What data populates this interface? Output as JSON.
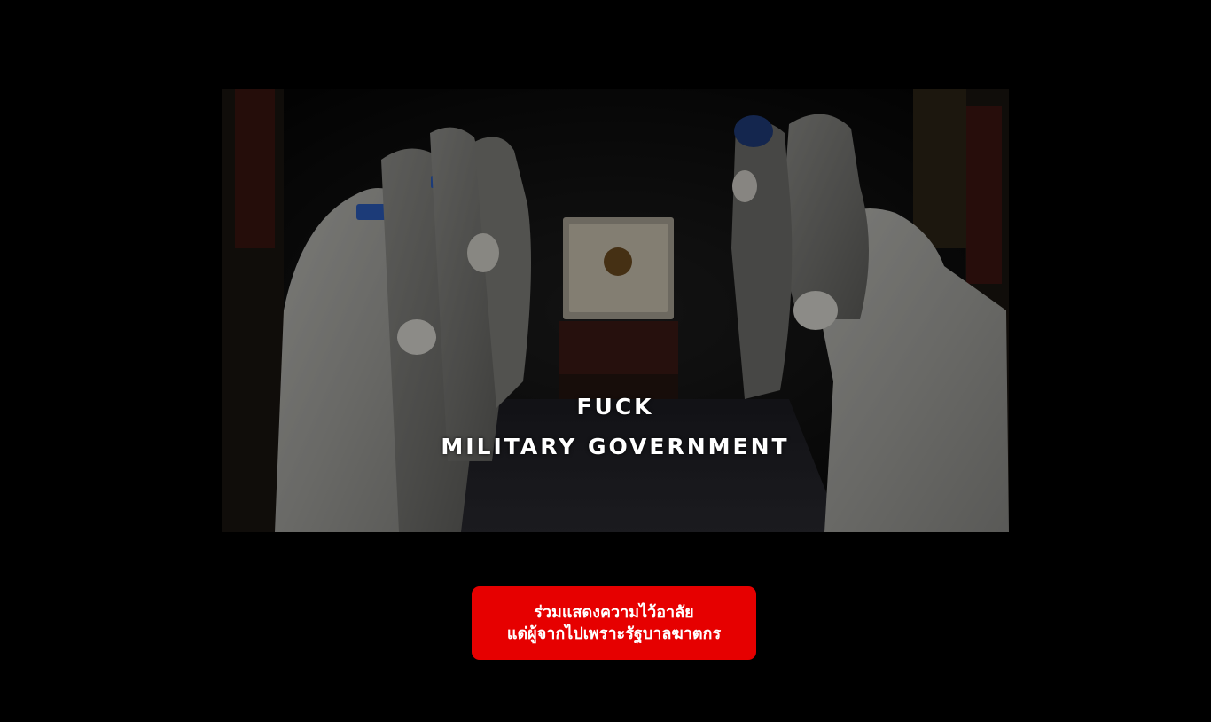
{
  "hero": {
    "caption_line1": "FUCK",
    "caption_line2": "MILITARY GOVERNMENT"
  },
  "cta": {
    "line1": "ร่วมแสดงความไว้อาลัย",
    "line2": "แด่ผู้จากไปเพราะรัฐบาลฆาตกร"
  },
  "colors": {
    "background": "#000000",
    "cta_background": "#e60000",
    "text": "#ffffff"
  }
}
